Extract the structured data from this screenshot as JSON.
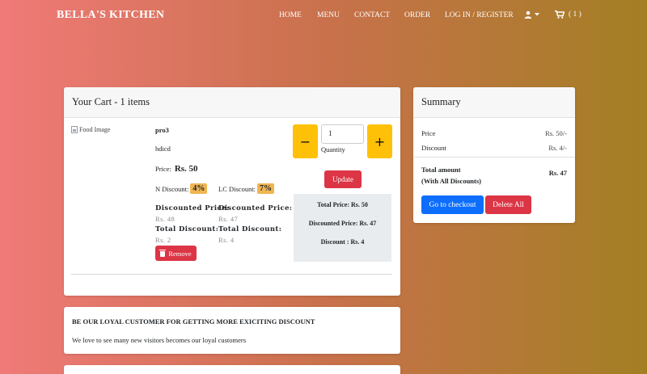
{
  "nav": {
    "brand": "BELLA'S KITCHEN",
    "links": [
      "HOME",
      "MENU",
      "CONTACT",
      "ORDER",
      "LOG IN / REGISTER"
    ],
    "cart_count": "( 1 )",
    "icons": [
      "user-icon",
      "caret-down-icon",
      "shopping-cart-icon"
    ]
  },
  "cart": {
    "title": "Your Cart - 1 items",
    "item": {
      "image_alt": "Food Image",
      "name": "pro3",
      "description": "hdicd",
      "price_label": "Price:",
      "price": "Rs. 50",
      "n_discount_label": "N Discount:",
      "n_discount": "4%",
      "lc_discount_label": "LC Discount:",
      "lc_discount": "7%",
      "disc_price_label": "Discounted Price:",
      "n_disc_price": "Rs. 48",
      "lc_disc_price": "Rs. 47",
      "total_disc_label": "Total Discount:",
      "n_total_disc": "Rs. 2",
      "lc_total_disc": "Rs. 4",
      "remove_label": "Remove",
      "quantity": "1",
      "quantity_label": "Quantity",
      "minus": "−",
      "plus": "+",
      "update_label": "Update",
      "total_price": "Total Price: Rs. 50",
      "discounted_price": "Discounted Price: Rs. 47",
      "discount": "Discount : Rs. 4"
    }
  },
  "summary": {
    "title": "Summary",
    "price_label": "Price",
    "price_value": "Rs. 50/-",
    "discount_label": "Discount",
    "discount_value": "Rs. 4/-",
    "total_label_1": "Total amount",
    "total_label_2": "(With All Discounts)",
    "total_value": "Rs. 47",
    "checkout_label": "Go to checkout",
    "delete_all_label": "Delete All"
  },
  "loyal": {
    "title": "BE OUR LOYAL CUSTOMER FOR GETTING MORE EXICITING DISCOUNT",
    "text": "We love to see many new visitors becomes our loyal customers"
  },
  "colors": {
    "gradient_start": "#f07a78",
    "gradient_end": "#a37f24",
    "qty_button": "#ffc107",
    "danger": "#dc3545",
    "primary": "#0d6efd",
    "discount_badge": "#f0b552"
  }
}
